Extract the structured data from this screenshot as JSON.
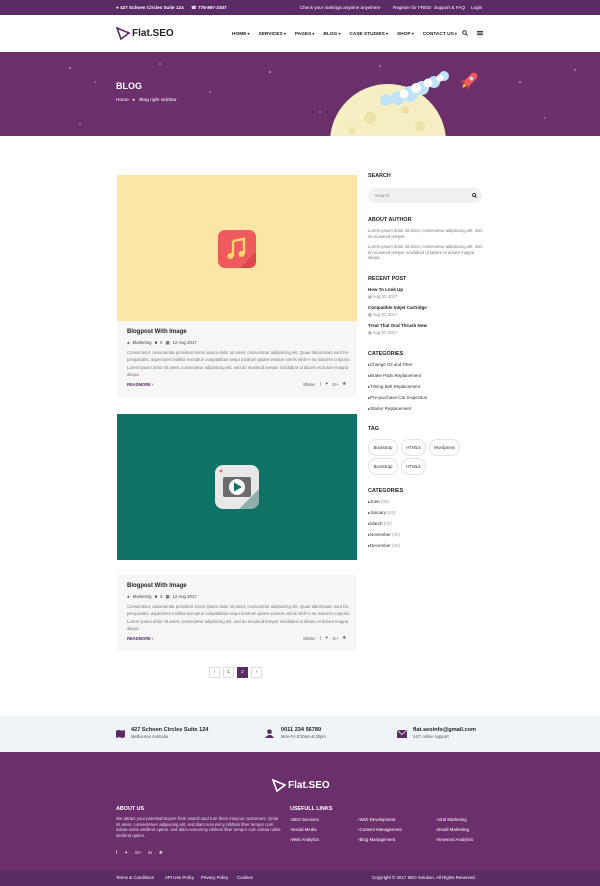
{
  "topbar": {
    "address": "427 Schoen Circles Suite 124",
    "phone": "778-897-2407",
    "rankings": "Check your rankings anytime anywhere",
    "register": "Register for FREE!",
    "support": "Support & FAQ",
    "login": "Login"
  },
  "brand": {
    "name": "Flat.SEO"
  },
  "nav": [
    "HOME",
    "SERVICES",
    "PAGES",
    "BLOG",
    "CASE STUDIES",
    "SHOP",
    "CONTACT US"
  ],
  "hero": {
    "title": "BLOG",
    "crumb_home": "Home",
    "crumb_current": "Blog right sidebar"
  },
  "posts": [
    {
      "title": "Blogpost With Image",
      "category": "Marketing",
      "comments": "5",
      "date": "12 Aug 2017",
      "excerpt": "Consectetur, assumenda provident lorem ipsum dolor sit amet, consectetur adipisicing elit. Quae laboriosam sunt hic perspiciatis, asperiores mollitia excepturi voluptatibus sequi nostrum ipsam veniam omnis nihil! A ea maiores corporis. Lorem ipsum dolor sit amet, consectetur adipisicing elit, sed do eiusmod tempor incididunt ut labore et dolore magna aliqua.",
      "readmore": "READMORE",
      "share": "Share:"
    },
    {
      "title": "Blogpost With Image",
      "category": "Marketing",
      "comments": "5",
      "date": "12 Aug 2017",
      "excerpt": "Consectetur, assumenda provident lorem ipsum dolor sit amet, consectetur adipisicing elit. Quae laboriosam sunt hic perspiciatis, asperiores mollitia excepturi voluptatibus sequi nostrum ipsam veniam omnis nihil! A ea maiores corporis. Lorem ipsum dolor sit amet, consectetur adipisicing elit, sed do eiusmod tempor incididunt ut labore et dolore magna aliqua.",
      "readmore": "READMORE",
      "share": "Share:"
    }
  ],
  "pagination": [
    "1",
    "2"
  ],
  "sidebar": {
    "search_title": "SEARCH",
    "search_placeholder": "Search",
    "about_title": "ABOUT AUTHOR",
    "about_p1": "Lorem ipsum dolor sit amet, consectetur adipisicing elit, sed do eiusmod tempor.",
    "about_p2": "Lorem ipsum dolor sit amet, consectetur adipisicing elit, sed do eiusmod tempor incididunt ut labore et dolore magna aliqua.",
    "recent_title": "RECENT POST",
    "recent": [
      {
        "title": "How To Look Up",
        "date": "Aug 20, 2017"
      },
      {
        "title": "Compatible Inkjet Cartridge",
        "date": "Aug 20, 2017"
      },
      {
        "title": "Treat That Oral Thrush Now",
        "date": "Aug 20, 2017"
      }
    ],
    "categories_title": "CATEGORIES",
    "categories": [
      "Change Oil and Filter",
      "Brake Pads Replacement",
      "Timing Belt Replacement",
      "Pre-purchase Car Inspection",
      "Starter Replacement"
    ],
    "tag_title": "TAG",
    "tags": [
      "Bootstrap",
      "HTML5",
      "Wordpress",
      "Bootstrap",
      "HTML5"
    ],
    "archive_title": "CATEGORIES",
    "archive": [
      {
        "month": "June",
        "count": "(02)"
      },
      {
        "month": "January",
        "count": "(02)"
      },
      {
        "month": "March",
        "count": "(02)"
      },
      {
        "month": "November",
        "count": "(02)"
      },
      {
        "month": "December",
        "count": "(02)"
      }
    ]
  },
  "contact": {
    "address_title": "427 Schoen Circles Suite 124",
    "address_sub": "Melbourne Australia",
    "phone_title": "0011 234 56789",
    "phone_sub": "Mon-Fri 8:30am-6:30pm",
    "email_title": "flat.seoinfo@gmail.com",
    "email_sub": "24/7 online support"
  },
  "footer": {
    "about_title": "ABOUT US",
    "about_text": "We attract your potential buyers from search and turn them intoyour customers. Qolar sit amet, consectetuer adipiscing elit, sed diam nonummy nibham liber tempor cum soluta nobis eleifend option. sed diam nonummy nibhem liber tempor cum soluta nobis eleifend option.",
    "links_title": "USEFULL LINKS",
    "links": [
      [
        "SEO Services",
        "Web Development",
        "Viral Marketing"
      ],
      [
        "Social Media",
        "Content Management",
        "Email Marketing"
      ],
      [
        "Web Analytics",
        "Blog Management",
        "Keyword Analytics"
      ]
    ],
    "bottom_links": [
      "Terms & Conditions",
      "API Use Policy",
      "Privacy Policy",
      "Cookies"
    ],
    "copyright": "Copyright © 2017 SEO Solution. All Rights Reserved."
  },
  "colors": {
    "brand": "#6b2f6c",
    "post1_bg": "#fbe6a6",
    "post2_bg": "#0e7366",
    "music_icon": "#ef5a5f"
  }
}
